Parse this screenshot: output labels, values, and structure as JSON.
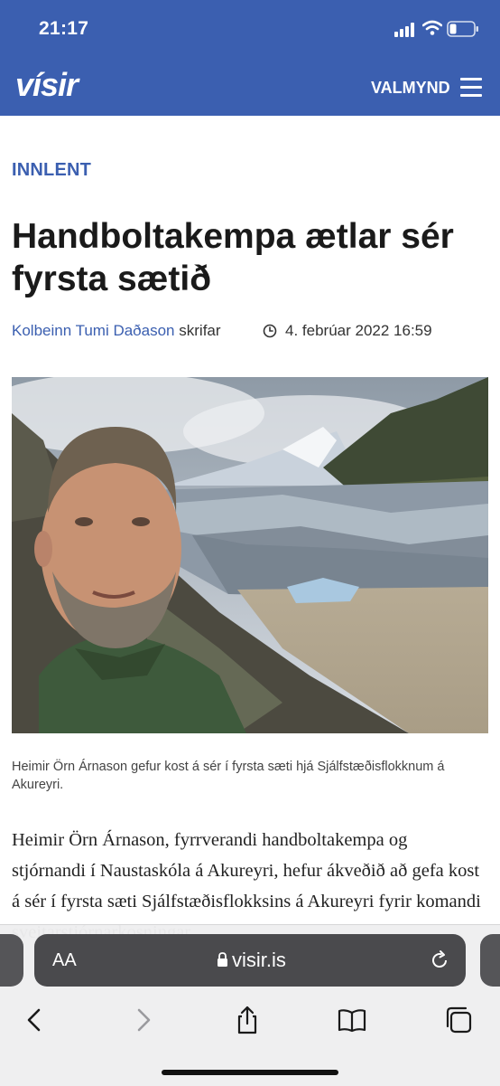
{
  "status_bar": {
    "time": "21:17"
  },
  "site": {
    "logo": "vísir",
    "menu_label": "VALMYND"
  },
  "article": {
    "category": "INNLENT",
    "headline": "Handboltakempa ætlar sér fyrsta sætið",
    "author": "Kolbeinn Tumi Daðason",
    "author_suffix": "skrifar",
    "date": "4. febrúar 2022 16:59",
    "caption": "Heimir Örn Árnason gefur kost á sér í fyrsta sæti hjá Sjálfstæðisflokknum á Akureyri.",
    "body": "Heimir Örn Árnason, fyrrverandi handboltakempa og stjórnandi í Naustaskóla á Akureyri, hefur ákveðið að gefa kost á sér í fyrsta sæti Sjálfstæðisflokksins á Akureyri fyrir komandi sveitarstjórnarkosningar."
  },
  "browser": {
    "text_size_label": "AA",
    "url": "visir.is"
  },
  "colors": {
    "brand": "#3b5fb0",
    "text": "#1a1a1a"
  },
  "icons": [
    "signal-icon",
    "wifi-icon",
    "battery-icon",
    "hamburger-icon",
    "clock-icon",
    "lock-icon",
    "reload-icon",
    "back-icon",
    "forward-icon",
    "share-icon",
    "bookmarks-icon",
    "tabs-icon"
  ]
}
